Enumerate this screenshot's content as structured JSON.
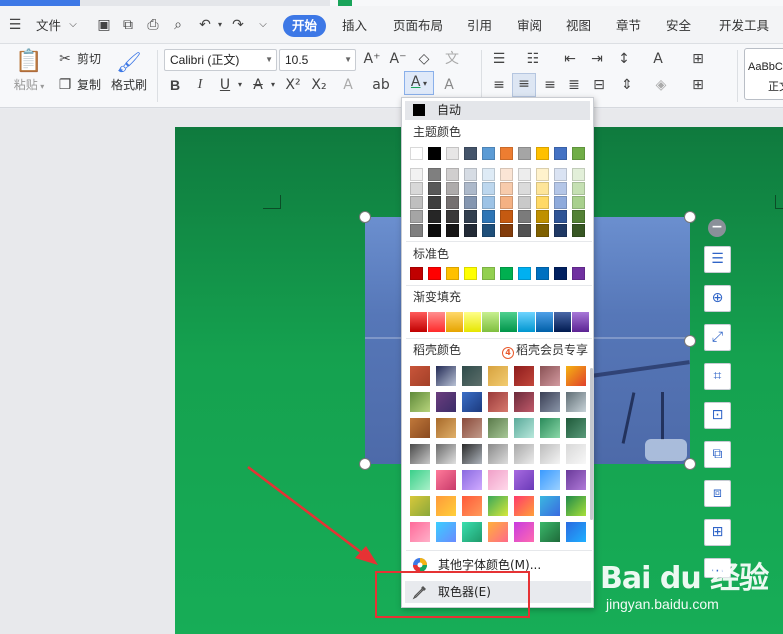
{
  "menubar": {
    "file_label": "文件",
    "tabs": [
      "开始",
      "插入",
      "页面布局",
      "引用",
      "审阅",
      "视图",
      "章节",
      "安全",
      "开发工具"
    ]
  },
  "ribbon": {
    "paste": "粘贴",
    "cut": "剪切",
    "copy": "复制",
    "format_painter": "格式刷",
    "font_name": "Calibri (正文)",
    "font_size": "10.5",
    "style_preview": "AaBbC",
    "style_name": "正文"
  },
  "color_picker": {
    "auto_label": "自动",
    "theme_heading": "主题颜色",
    "theme_top": [
      "#ffffff",
      "#000000",
      "#e7e6e6",
      "#44546a",
      "#5b9bd5",
      "#ed7d31",
      "#a5a5a5",
      "#ffc000",
      "#4472c4",
      "#70ad47"
    ],
    "theme_shades": [
      [
        "#f2f2f2",
        "#7f7f7f",
        "#d0cece",
        "#d6dce4",
        "#deebf6",
        "#fbe5d5",
        "#ededed",
        "#fff2cc",
        "#dae3f3",
        "#e2efd9"
      ],
      [
        "#d8d8d8",
        "#595959",
        "#aeabab",
        "#adb9ca",
        "#bdd7ee",
        "#f7cbac",
        "#dbdbdb",
        "#fee599",
        "#b4c6e7",
        "#c5e0b3"
      ],
      [
        "#bfbfbf",
        "#3f3f3f",
        "#757070",
        "#8496b0",
        "#9dc3e6",
        "#f4b183",
        "#c9c9c9",
        "#ffd965",
        "#8eaadb",
        "#a8d08d"
      ],
      [
        "#a5a5a5",
        "#262626",
        "#3a3838",
        "#323f4f",
        "#2e75b5",
        "#c55a11",
        "#7b7b7b",
        "#bf9000",
        "#2f5496",
        "#538135"
      ],
      [
        "#7f7f7f",
        "#0c0c0c",
        "#171616",
        "#222a35",
        "#1e4e79",
        "#833c0b",
        "#525252",
        "#7f6000",
        "#1f3864",
        "#375623"
      ]
    ],
    "standard_heading": "标准色",
    "standard_colors": [
      "#c00000",
      "#ff0000",
      "#ffc000",
      "#ffff00",
      "#92d050",
      "#00b050",
      "#00b0f0",
      "#0070c0",
      "#002060",
      "#7030a0"
    ],
    "gradient_heading": "渐变填充",
    "gradient_fills": [
      [
        "#c00000",
        "#ff5b5b"
      ],
      [
        "#ff2b2b",
        "#ff8f8f"
      ],
      [
        "#e6a400",
        "#ffd86b"
      ],
      [
        "#e6e600",
        "#ffff8a"
      ],
      [
        "#7fbf3f",
        "#c7ef8f"
      ],
      [
        "#00954a",
        "#4fd08f"
      ],
      [
        "#0096d0",
        "#6fd4ff"
      ],
      [
        "#005fa8",
        "#4fa0e8"
      ],
      [
        "#001a50",
        "#4a68a8"
      ],
      [
        "#5b2393",
        "#a878d8"
      ]
    ],
    "shell_heading": "稻壳颜色",
    "shell_member": "稻壳会员专享",
    "shell_grid": [
      [
        [
          "#c8553a",
          "#a34028"
        ],
        [
          "#222a55",
          "#b8c1d4"
        ],
        [
          "#2f4b4a",
          "#5d6f6b"
        ],
        [
          "#d7a23f",
          "#f2cc71"
        ],
        [
          "#8e1c1c",
          "#c2473b"
        ],
        [
          "#8a5255",
          "#d39aa0"
        ],
        [
          "#f5b312",
          "#e0402b"
        ]
      ],
      [
        [
          "#5f8a3a",
          "#b7d47c"
        ],
        [
          "#6b3d7e",
          "#3b2d68"
        ],
        [
          "#3b6fc7",
          "#1c3a7e"
        ],
        [
          "#9a3a3a",
          "#d77a6e"
        ],
        [
          "#6b2a3a",
          "#c05a6a"
        ],
        [
          "#3a3f55",
          "#8a95a8"
        ],
        [
          "#5f6d74",
          "#c8d3d8"
        ]
      ],
      [
        [
          "#c0783a",
          "#8a4a20"
        ],
        [
          "#a86a2a",
          "#e0b06a"
        ],
        [
          "#8a4a3a",
          "#c29a8a"
        ],
        [
          "#5a7a4a",
          "#a8c898"
        ],
        [
          "#5aaa9a",
          "#b8e8dc"
        ],
        [
          "#2a8a5a",
          "#8ad8a8"
        ],
        [
          "#1f5a3a",
          "#5a9a7a"
        ]
      ],
      [
        [
          "#4a4a4a",
          "#c8c8c8"
        ],
        [
          "#6a6a6a",
          "#e0e0e0"
        ],
        [
          "#2a2a2a",
          "#aeb4bc"
        ],
        [
          "#8a8a8a",
          "#dcdcdc"
        ],
        [
          "#a8a8a8",
          "#ececec"
        ],
        [
          "#bcbcbc",
          "#f4f4f4"
        ],
        [
          "#d8d8d8",
          "#f8f8f8"
        ]
      ],
      [
        [
          "#3acf8a",
          "#a8f0c8"
        ],
        [
          "#ff7a9a",
          "#c83a6a"
        ],
        [
          "#8a6ae0",
          "#d0aaff"
        ],
        [
          "#f0a0c8",
          "#ffd8ea"
        ],
        [
          "#a86ae0",
          "#6a3ab8"
        ],
        [
          "#3a9aff",
          "#9ad0ff"
        ],
        [
          "#6a3a9a",
          "#b07ad8"
        ]
      ],
      [
        [
          "#d8c83a",
          "#8aa83a"
        ],
        [
          "#ff9a3a",
          "#ffd03a"
        ],
        [
          "#ff5a3a",
          "#ff9a5a"
        ],
        [
          "#3aa85a",
          "#d8e83a"
        ],
        [
          "#ff3a6a",
          "#ffa03a"
        ],
        [
          "#3ab8e0",
          "#3a6ae0"
        ],
        [
          "#1f8a4a",
          "#a8e03a"
        ]
      ],
      [
        [
          "#ff6a9a",
          "#ffb0c8"
        ],
        [
          "#3acfff",
          "#6a8aff"
        ],
        [
          "#3adfb0",
          "#1f9a6a"
        ],
        [
          "#ffb03a",
          "#ff6a8a"
        ],
        [
          "#c83ae0",
          "#ff6ab0"
        ],
        [
          "#3ab86a",
          "#1f6a3a"
        ],
        [
          "#2a6ae0",
          "#1fb0ff"
        ]
      ]
    ],
    "more_colors": "其他字体颜色(M)...",
    "eyedropper": "取色器(E)"
  },
  "watermark": {
    "logo_text": "Bai du 经验",
    "url": "jingyan.baidu.com"
  },
  "colors": {
    "accent_blue": "#3d78e6",
    "page_green": "#17ad57",
    "highlight_red": "#e63234"
  }
}
